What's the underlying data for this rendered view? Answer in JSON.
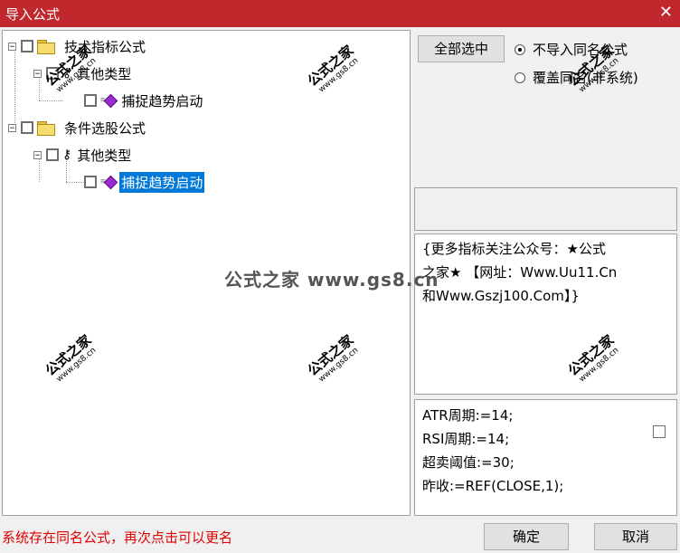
{
  "window": {
    "title": "导入公式",
    "close_glyph": "✕"
  },
  "tree": {
    "cat1": "技术指标公式",
    "cat1_sub": "其他类型",
    "cat1_item": "捕捉趋势启动",
    "cat2": "条件选股公式",
    "cat2_sub": "其他类型",
    "cat2_item": "捕捉趋势启动",
    "expander_glyph": "−"
  },
  "options": {
    "select_all": "全部选中",
    "radio1": "不导入同名公式",
    "radio2": "覆盖同名(非系统)",
    "selected_radio": 1
  },
  "description": {
    "lines": [
      "{更多指标关注公众号：★公式",
      "之家★ 【网址：Www.Uu11.Cn",
      "和Www.Gszj100.Com】}"
    ]
  },
  "params": {
    "lines": [
      "ATR周期:=14;",
      "RSI周期:=14;",
      "超卖阈值:=30;",
      "昨收:=REF(CLOSE,1);"
    ]
  },
  "status": {
    "message": "系统存在同名公式，再次点击可以更名"
  },
  "footer": {
    "ok": "确定",
    "cancel": "取消"
  },
  "watermark": {
    "text": "公式之家",
    "url": "www.gs8.cn",
    "center": "公式之家 www.gs8.cn"
  },
  "colors": {
    "title_bar": "#c0282d",
    "status": "#e00000",
    "selection": "#0078d7"
  }
}
